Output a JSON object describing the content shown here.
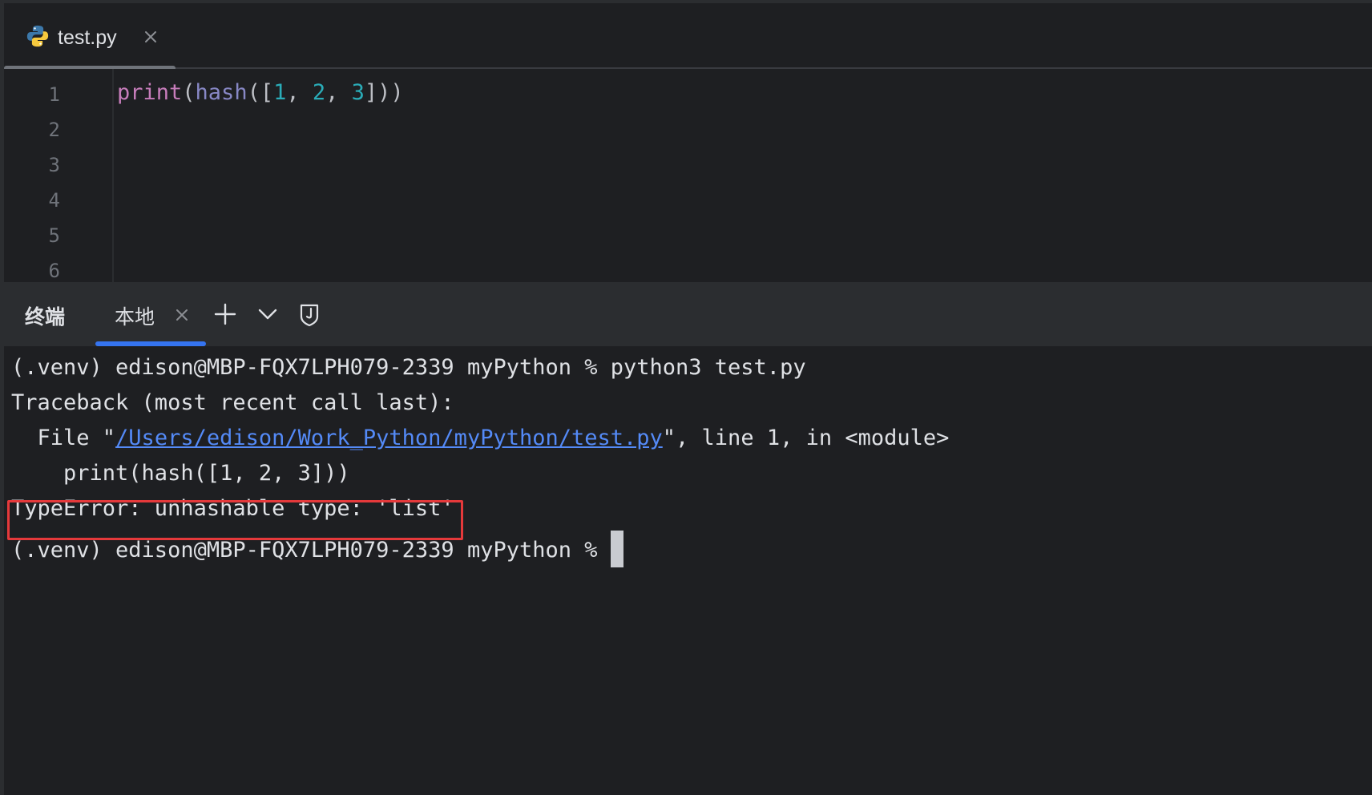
{
  "editor": {
    "tab": {
      "label": "test.py",
      "icon": "python-icon"
    },
    "line_numbers": [
      "1",
      "2",
      "3",
      "4",
      "5",
      "6"
    ],
    "code": {
      "line1": {
        "fn": "print",
        "p1": "(",
        "builtin": "hash",
        "p2": "([",
        "n1": "1",
        "c1": ", ",
        "n2": "2",
        "c2": ", ",
        "n3": "3",
        "p3": "]))"
      }
    },
    "colors": {
      "function": "#c77dbb",
      "builtin": "#8888c6",
      "number": "#2aacb8",
      "punctuation": "#bcbec4"
    }
  },
  "terminal": {
    "title": "终端",
    "tab_label": "本地",
    "lines": {
      "prompt1": "(.venv) edison@MBP-FQX7LPH079-2339 myPython % python3 test.py",
      "traceback": "Traceback (most recent call last):",
      "file_prefix": "  File \"",
      "file_link": "/Users/edison/Work_Python/myPython/test.py",
      "file_suffix": "\", line 1, in <module>",
      "code_echo": "    print(hash([1, 2, 3]))",
      "error": "TypeError: unhashable type: 'list'",
      "prompt2": "(.venv) edison@MBP-FQX7LPH079-2339 myPython % "
    },
    "colors": {
      "accent": "#3574f0",
      "link": "#548af7",
      "error_highlight": "#e5393b"
    }
  }
}
